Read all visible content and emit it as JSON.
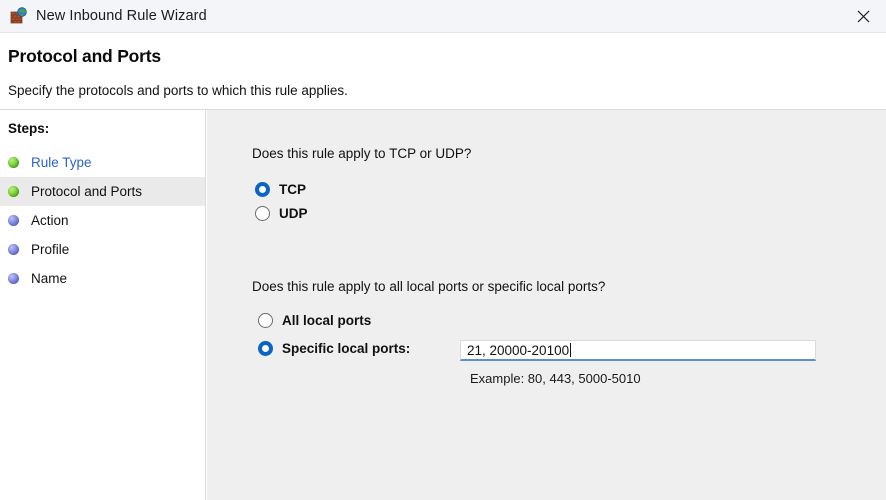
{
  "window": {
    "title": "New Inbound Rule Wizard",
    "icon": "firewall-globe-icon",
    "close_label": "Close"
  },
  "header": {
    "title": "Protocol and Ports",
    "subtitle": "Specify the protocols and ports to which this rule applies."
  },
  "sidebar": {
    "heading": "Steps:",
    "items": [
      {
        "label": "Rule Type",
        "state": "completed",
        "bullet": "green",
        "link": true,
        "current": false
      },
      {
        "label": "Protocol and Ports",
        "state": "current",
        "bullet": "green",
        "link": false,
        "current": true
      },
      {
        "label": "Action",
        "state": "pending",
        "bullet": "blue",
        "link": false,
        "current": false
      },
      {
        "label": "Profile",
        "state": "pending",
        "bullet": "blue",
        "link": false,
        "current": false
      },
      {
        "label": "Name",
        "state": "pending",
        "bullet": "blue",
        "link": false,
        "current": false
      }
    ]
  },
  "main": {
    "protocol_question": "Does this rule apply to TCP or UDP?",
    "protocol_options": [
      {
        "label": "TCP",
        "selected": true
      },
      {
        "label": "UDP",
        "selected": false
      }
    ],
    "ports_question": "Does this rule apply to all local ports or specific local ports?",
    "ports_options": [
      {
        "label": "All local ports",
        "selected": false
      },
      {
        "label": "Specific local ports:",
        "selected": true
      }
    ],
    "ports_input": {
      "value": "21, 20000-20100",
      "placeholder": "",
      "focused": true
    },
    "ports_example": "Example: 80, 443, 5000-5010"
  },
  "colors": {
    "accent_blue": "#0b63c5",
    "link_blue": "#2a63c8",
    "panel_gray": "#efefef",
    "titlebar": "#f3f5f8",
    "current_step_bg": "#eaeaea",
    "input_underline": "#5b93c9",
    "bullet_green": "#4aa317",
    "bullet_blue": "#5b62c9"
  }
}
